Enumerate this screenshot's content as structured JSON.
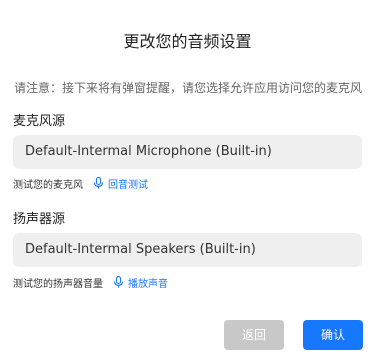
{
  "dialog": {
    "title": "更改您的音频设置",
    "notice": "请注意：接下来将有弹窗提醒，请您选择允许应用访问您的麦克风"
  },
  "microphone": {
    "section_label": "麦克风源",
    "selected_device": "Default-Intermal Microphone (Built-in)",
    "test_label": "测试您的麦克风",
    "test_link": "回音测试",
    "test_link_icon": "microphone-icon"
  },
  "speaker": {
    "section_label": "扬声器源",
    "selected_device": "Default-Intermal Speakers (Built-in)",
    "test_label": "测试您的扬声器音量",
    "test_link": "播放声音",
    "test_link_icon": "microphone-icon"
  },
  "buttons": {
    "back_label": "返回",
    "confirm_label": "确认"
  },
  "colors": {
    "accent": "#1677ff",
    "disabled_button": "#c8c8c8",
    "select_background": "#efefef"
  }
}
